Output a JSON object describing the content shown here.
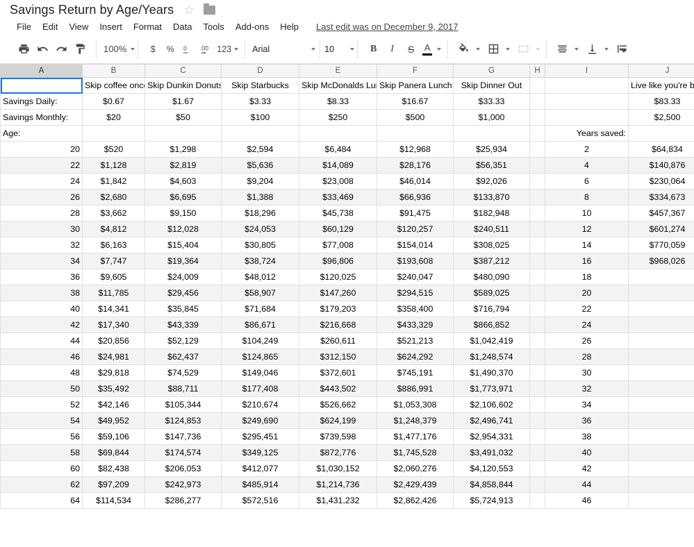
{
  "titlebar": {
    "doc_title": "Savings Return by Age/Years",
    "star_glyph": "☆",
    "star_icon_name": "star-icon",
    "folder_icon_name": "folder-icon"
  },
  "menubar": {
    "items": [
      "File",
      "Edit",
      "View",
      "Insert",
      "Format",
      "Data",
      "Tools",
      "Add-ons",
      "Help"
    ],
    "last_edit": "Last edit was on December 9, 2017"
  },
  "toolbar": {
    "zoom": "100%",
    "currency": "$",
    "percent": "%",
    "decrease_decimal": ".0",
    "increase_decimal": ".00",
    "more_formats": "123",
    "font_family": "Arial",
    "font_size": "10",
    "bold": "B",
    "italic": "I",
    "strikethrough": "S",
    "text_color": "A",
    "text_color_hex": "#000000",
    "accent_hex": "#1a73e8",
    "icons": [
      "print-icon",
      "undo-icon",
      "redo-icon",
      "paint-format-icon",
      "fill-color-icon",
      "borders-icon",
      "merge-cells-icon",
      "horizontal-align-icon",
      "vertical-align-icon",
      "text-wrap-icon"
    ]
  },
  "sheet": {
    "columns": [
      "A",
      "B",
      "C",
      "D",
      "E",
      "F",
      "G",
      "H",
      "I",
      "J"
    ],
    "active_column": "A",
    "selected_cell": "A1",
    "row1": {
      "a": "",
      "b": "Skip coffee once weekly",
      "c": "Skip Dunkin Donuts",
      "d": "Skip Starbucks",
      "e": "Skip McDonalds Lunch",
      "f": "Skip Panera Lunch",
      "g": "Skip Dinner Out",
      "h": "",
      "i": "",
      "j": "Live like you're broke"
    },
    "row_savings_daily": {
      "label": "Savings Daily:",
      "values": [
        "$0.67",
        "$1.67",
        "$3.33",
        "$8.33",
        "$16.67",
        "$33.33"
      ],
      "h": "",
      "i": "",
      "j": "$83.33"
    },
    "row_savings_monthly": {
      "label": "Savings Monthly:",
      "values": [
        "$20",
        "$50",
        "$100",
        "$250",
        "$500",
        "$1,000"
      ],
      "h": "",
      "i": "",
      "j": "$2,500"
    },
    "row_age_header": {
      "label": "Age:",
      "years_saved_label": "Years saved:"
    },
    "data_rows": [
      {
        "age": "20",
        "vals": [
          "$520",
          "$1,298",
          "$2,594",
          "$6,484",
          "$12,968",
          "$25,934"
        ],
        "years": "2",
        "broke": "$64,834"
      },
      {
        "age": "22",
        "vals": [
          "$1,128",
          "$2,819",
          "$5,636",
          "$14,089",
          "$28,176",
          "$56,351"
        ],
        "years": "4",
        "broke": "$140,876"
      },
      {
        "age": "24",
        "vals": [
          "$1,842",
          "$4,603",
          "$9,204",
          "$23,008",
          "$46,014",
          "$92,026"
        ],
        "years": "6",
        "broke": "$230,064"
      },
      {
        "age": "26",
        "vals": [
          "$2,680",
          "$6,695",
          "$1,388",
          "$33,469",
          "$66,936",
          "$133,870"
        ],
        "years": "8",
        "broke": "$334,673"
      },
      {
        "age": "28",
        "vals": [
          "$3,662",
          "$9,150",
          "$18,296",
          "$45,738",
          "$91,475",
          "$182,948"
        ],
        "years": "10",
        "broke": "$457,367"
      },
      {
        "age": "30",
        "vals": [
          "$4,812",
          "$12,028",
          "$24,053",
          "$60,129",
          "$120,257",
          "$240,511"
        ],
        "years": "12",
        "broke": "$601,274"
      },
      {
        "age": "32",
        "vals": [
          "$6,163",
          "$15,404",
          "$30,805",
          "$77,008",
          "$154,014",
          "$308,025"
        ],
        "years": "14",
        "broke": "$770,059"
      },
      {
        "age": "34",
        "vals": [
          "$7,747",
          "$19,364",
          "$38,724",
          "$96,806",
          "$193,608",
          "$387,212"
        ],
        "years": "16",
        "broke": "$968,026"
      },
      {
        "age": "36",
        "vals": [
          "$9,605",
          "$24,009",
          "$48,012",
          "$120,025",
          "$240,047",
          "$480,090"
        ],
        "years": "18",
        "broke": ""
      },
      {
        "age": "38",
        "vals": [
          "$11,785",
          "$29,456",
          "$58,907",
          "$147,260",
          "$294,515",
          "$589,025"
        ],
        "years": "20",
        "broke": ""
      },
      {
        "age": "40",
        "vals": [
          "$14,341",
          "$35,845",
          "$71,684",
          "$179,203",
          "$358,400",
          "$716,794"
        ],
        "years": "22",
        "broke": ""
      },
      {
        "age": "42",
        "vals": [
          "$17,340",
          "$43,339",
          "$86,671",
          "$216,668",
          "$433,329",
          "$866,852"
        ],
        "years": "24",
        "broke": ""
      },
      {
        "age": "44",
        "vals": [
          "$20,856",
          "$52,129",
          "$104,249",
          "$260,611",
          "$521,213",
          "$1,042,419"
        ],
        "years": "26",
        "broke": ""
      },
      {
        "age": "46",
        "vals": [
          "$24,981",
          "$62,437",
          "$124,865",
          "$312,150",
          "$624,292",
          "$1,248,574"
        ],
        "years": "28",
        "broke": ""
      },
      {
        "age": "48",
        "vals": [
          "$29,818",
          "$74,529",
          "$149,046",
          "$372,601",
          "$745,191",
          "$1,490,370"
        ],
        "years": "30",
        "broke": ""
      },
      {
        "age": "50",
        "vals": [
          "$35,492",
          "$88,711",
          "$177,408",
          "$443,502",
          "$886,991",
          "$1,773,971"
        ],
        "years": "32",
        "broke": ""
      },
      {
        "age": "52",
        "vals": [
          "$42,146",
          "$105,344",
          "$210,674",
          "$526,662",
          "$1,053,308",
          "$2,106,602"
        ],
        "years": "34",
        "broke": ""
      },
      {
        "age": "54",
        "vals": [
          "$49,952",
          "$124,853",
          "$249,690",
          "$624,199",
          "$1,248,379",
          "$2,496,741"
        ],
        "years": "36",
        "broke": ""
      },
      {
        "age": "56",
        "vals": [
          "$59,106",
          "$147,736",
          "$295,451",
          "$739,598",
          "$1,477,176",
          "$2,954,331"
        ],
        "years": "38",
        "broke": ""
      },
      {
        "age": "58",
        "vals": [
          "$69,844",
          "$174,574",
          "$349,125",
          "$872,776",
          "$1,745,528",
          "$3,491,032"
        ],
        "years": "40",
        "broke": ""
      },
      {
        "age": "60",
        "vals": [
          "$82,438",
          "$206,053",
          "$412,077",
          "$1,030,152",
          "$2,060,276",
          "$4,120,553"
        ],
        "years": "42",
        "broke": ""
      },
      {
        "age": "62",
        "vals": [
          "$97,209",
          "$242,973",
          "$485,914",
          "$1,214,736",
          "$2,429,439",
          "$4,858,844"
        ],
        "years": "44",
        "broke": ""
      },
      {
        "age": "64",
        "vals": [
          "$114,534",
          "$286,277",
          "$572,516",
          "$1,431,232",
          "$2,862,426",
          "$5,724,913"
        ],
        "years": "46",
        "broke": ""
      }
    ]
  }
}
